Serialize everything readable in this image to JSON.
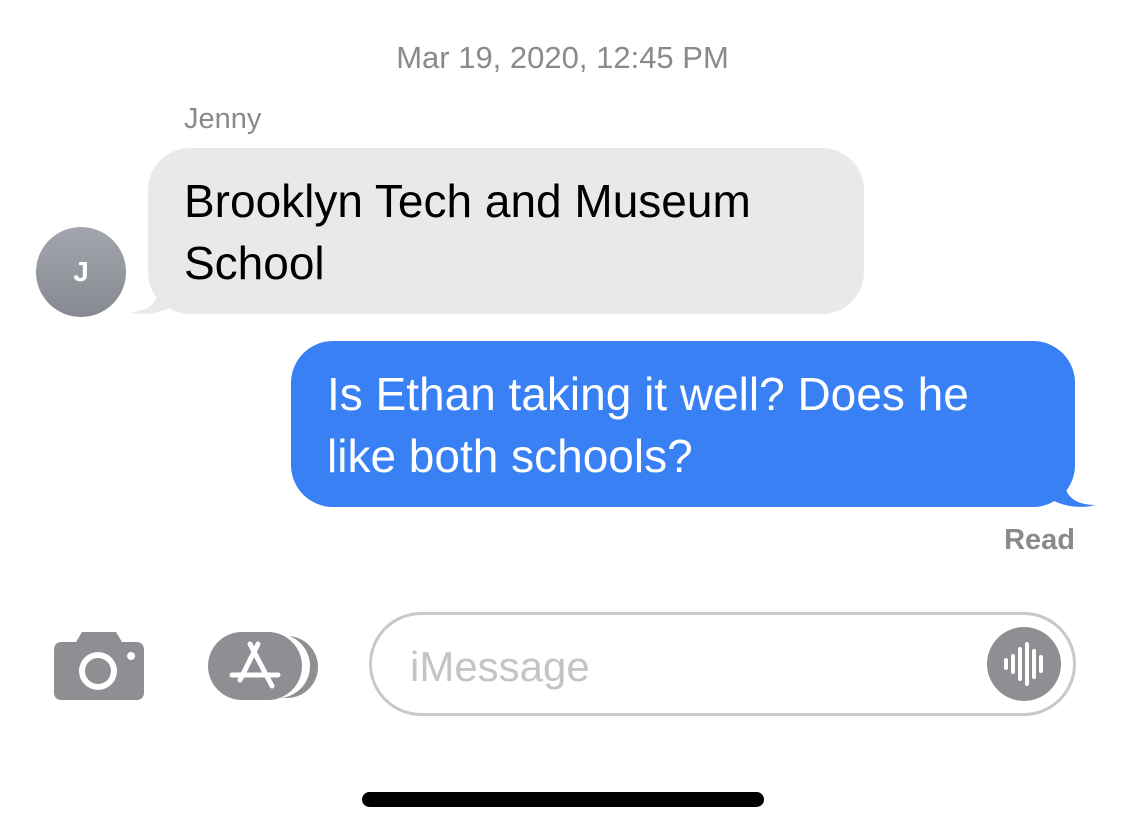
{
  "conversation": {
    "timestamp": "Mar 19, 2020, 12:45 PM",
    "sender_name": "Jenny",
    "avatar_initial": "J",
    "messages": [
      {
        "direction": "incoming",
        "line1": "Brooklyn Tech and Museum",
        "line2": "School"
      },
      {
        "direction": "outgoing",
        "line1": "Is Ethan taking it well? Does he",
        "line2": "like both schools?"
      }
    ],
    "read_receipt": "Read"
  },
  "composer": {
    "placeholder": "iMessage",
    "camera_icon": "camera-icon",
    "apps_icon": "app-store-icon",
    "audio_icon": "waveform-icon"
  },
  "colors": {
    "incoming_bubble": "#e9e9eb",
    "outgoing_bubble": "#3a80f5",
    "secondary_text": "#8a8a8e",
    "icon_gray": "#8e8e93"
  }
}
